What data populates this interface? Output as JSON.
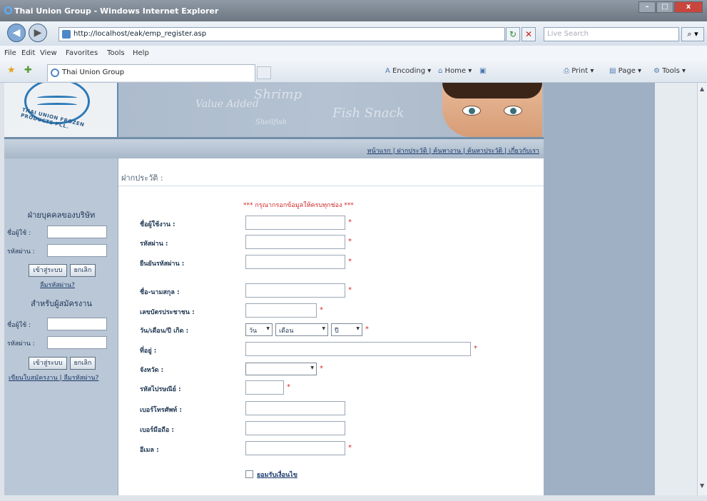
{
  "window": {
    "title": "Thai Union Group - Windows Internet Explorer",
    "controls": [
      "–",
      "□",
      "x"
    ]
  },
  "browser": {
    "back_icon": "back-arrow-icon",
    "forward_icon": "forward-arrow-icon",
    "url": "http://localhost/eak/emp_register.asp",
    "search_placeholder": "Live Search",
    "search_btn": "⌕ ▾",
    "menu": [
      "File",
      "Edit",
      "View",
      "Favorites",
      "Tools",
      "Help"
    ],
    "tab_title": "Thai Union Group",
    "commands": {
      "encoding": "Encoding",
      "home": "Home",
      "print": "Print",
      "page": "Page",
      "tools": "Tools"
    }
  },
  "banner": {
    "logo_text": "THAI UNION FROZEN PRODUCTS PCL.",
    "script_words": [
      "Shrimp",
      "Value Added",
      "Fish Snack",
      "Shellfish"
    ]
  },
  "nav": {
    "links": "หน้าแรก | ฝากประวัติ | ค้นหางาน | ค้นหาประวัติ | เกี่ยวกับเรา"
  },
  "sidebar": {
    "company_title": "ฝ่ายบุคคลของบริษัท",
    "username_label": "ชื่อผู้ใช้ :",
    "password_label": "รหัสผ่าน :",
    "login_btn": "เข้าสู่ระบบ",
    "cancel_btn": "ยกเลิก",
    "forgot_link": "ลืมรหัสผ่าน?",
    "applicant_title": "สำหรับผู้สมัครงาน",
    "username_label2": "ชื่อผู้ใช้ :",
    "password_label2": "รหัสผ่าน :",
    "login_btn2": "เข้าสู่ระบบ",
    "cancel_btn2": "ยกเลิก",
    "register_link": "เขียนใบสมัครงาน | ลืมรหัสผ่าน?"
  },
  "form": {
    "breadcrumb": "ฝากประวัติ :",
    "required_note": "*** กรุณากรอกข้อมูลให้ครบทุกช่อง ***",
    "labels": {
      "username": "ชื่อผู้ใช้งาน :",
      "password": "รหัสผ่าน :",
      "confirm": "ยืนยันรหัสผ่าน :",
      "fullname": "ชื่อ-นามสกุล :",
      "idcard": "เลขบัตรประชาชน :",
      "birthdate": "วัน/เดือน/ปี เกิด :",
      "address": "ที่อยู่ :",
      "province": "จังหวัด :",
      "postcode": "รหัสไปรษณีย์ :",
      "phone": "เบอร์โทรศัพท์ :",
      "mobile": "เบอร์มือถือ :",
      "email": "อีเมล :"
    },
    "birth_day": "วัน",
    "birth_month": "เดือน",
    "birth_year": "ปี",
    "province_value": "",
    "accept_label": "ยอมรับเงื่อนไข",
    "req_mark": "*"
  },
  "colors": {
    "required": "#d02a2a",
    "sidebar": "#bac7d6",
    "link": "#1b3a6b"
  }
}
